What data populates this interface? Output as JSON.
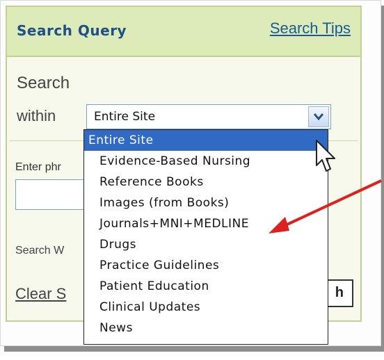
{
  "header": {
    "title": "Search Query",
    "tips_link": "Search Tips"
  },
  "form": {
    "search_label_line1": "Search",
    "search_label_line2": "within",
    "scope_selected": "Entire Site",
    "phrase_label": "Enter phr",
    "search_within_label": "Search W",
    "clear_link": "Clear S",
    "search_button_fragment": "h"
  },
  "dropdown": {
    "options": [
      "Entire Site",
      "Evidence-Based Nursing",
      "Reference Books",
      "Images (from Books)",
      "Journals+MNI+MEDLINE",
      "Drugs",
      "Practice Guidelines",
      "Patient Education",
      "Clinical Updates",
      "News"
    ],
    "selected_index": 0
  },
  "annotation": {
    "arrow_color": "#e0201c",
    "points_to": "Journals+MNI+MEDLINE"
  },
  "colors": {
    "header_bg": "#dcebb7",
    "panel_bg": "#f6f9ec",
    "title_color": "#1f4f86",
    "link_color": "#1a5a99",
    "selected_bg": "#316ac5"
  },
  "icons": {
    "dropdown": "chevron-down-icon",
    "pointer": "mouse-pointer-icon",
    "annotation": "red-arrow-icon"
  }
}
